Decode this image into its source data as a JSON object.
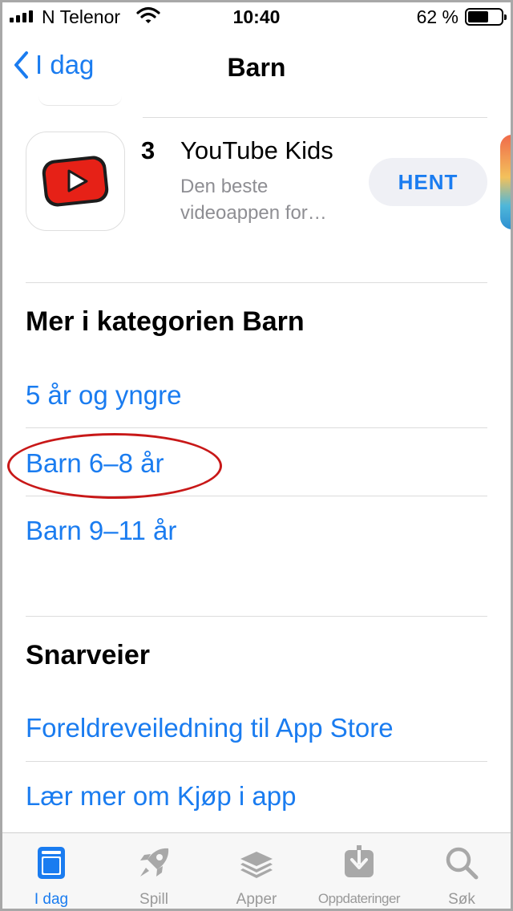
{
  "status_bar": {
    "carrier": "N Telenor",
    "time": "10:40",
    "battery_percent": "62 %",
    "battery_level": 0.62
  },
  "nav": {
    "back_label": "I dag",
    "title": "Barn"
  },
  "app": {
    "rank": "3",
    "name": "YouTube Kids",
    "subtitle": "Den beste videoappen for…",
    "get_label": "HENT"
  },
  "category_section": {
    "title": "Mer i kategorien Barn",
    "links": [
      "5 år og yngre",
      "Barn 6–8 år",
      "Barn 9–11 år"
    ]
  },
  "shortcuts_section": {
    "title": "Snarveier",
    "links": [
      "Foreldreveiledning til App Store",
      "Lær mer om Kjøp i app"
    ]
  },
  "tabbar": {
    "tabs": [
      {
        "label": "I dag",
        "icon": "today-icon",
        "active": true
      },
      {
        "label": "Spill",
        "icon": "rocket-icon",
        "active": false
      },
      {
        "label": "Apper",
        "icon": "layers-icon",
        "active": false
      },
      {
        "label": "Oppdateringer",
        "icon": "download-icon",
        "active": false
      },
      {
        "label": "Søk",
        "icon": "search-icon",
        "active": false
      }
    ]
  },
  "colors": {
    "accent": "#1a7cf0",
    "highlight": "#c81818",
    "youtube_red": "#e62117",
    "inactive": "#999999"
  }
}
